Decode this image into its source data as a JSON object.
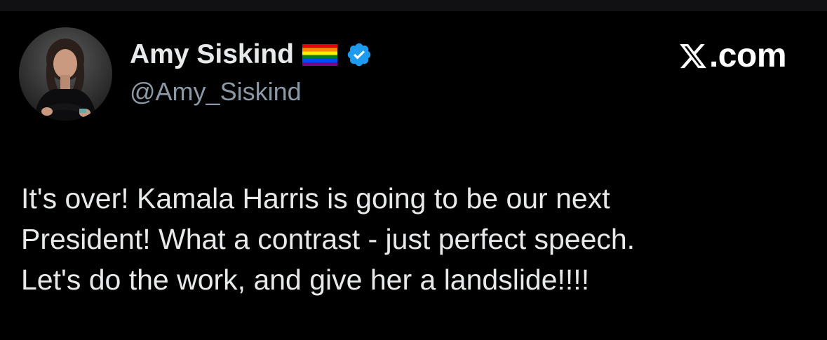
{
  "tweet": {
    "author": {
      "display_name": "Amy Siskind",
      "handle": "@Amy_Siskind",
      "flag_icon": "rainbow-flag-icon",
      "verified_icon": "verified-badge-icon",
      "verified_color": "#1d9bf0",
      "avatar_icon": "avatar"
    },
    "brand": {
      "logo_icon": "x-logo-icon",
      "text": ".com"
    },
    "text_lines": [
      "It's over! Kamala Harris is going to be our next",
      "President! What a contrast - just perfect speech.",
      "Let's do the work, and give her a landslide!!!!"
    ]
  },
  "colors": {
    "background": "#000000",
    "top_bar": "#111113",
    "primary_text": "#e7e9ea",
    "secondary_text": "#8b98a5",
    "brand_text": "#ffffff"
  }
}
